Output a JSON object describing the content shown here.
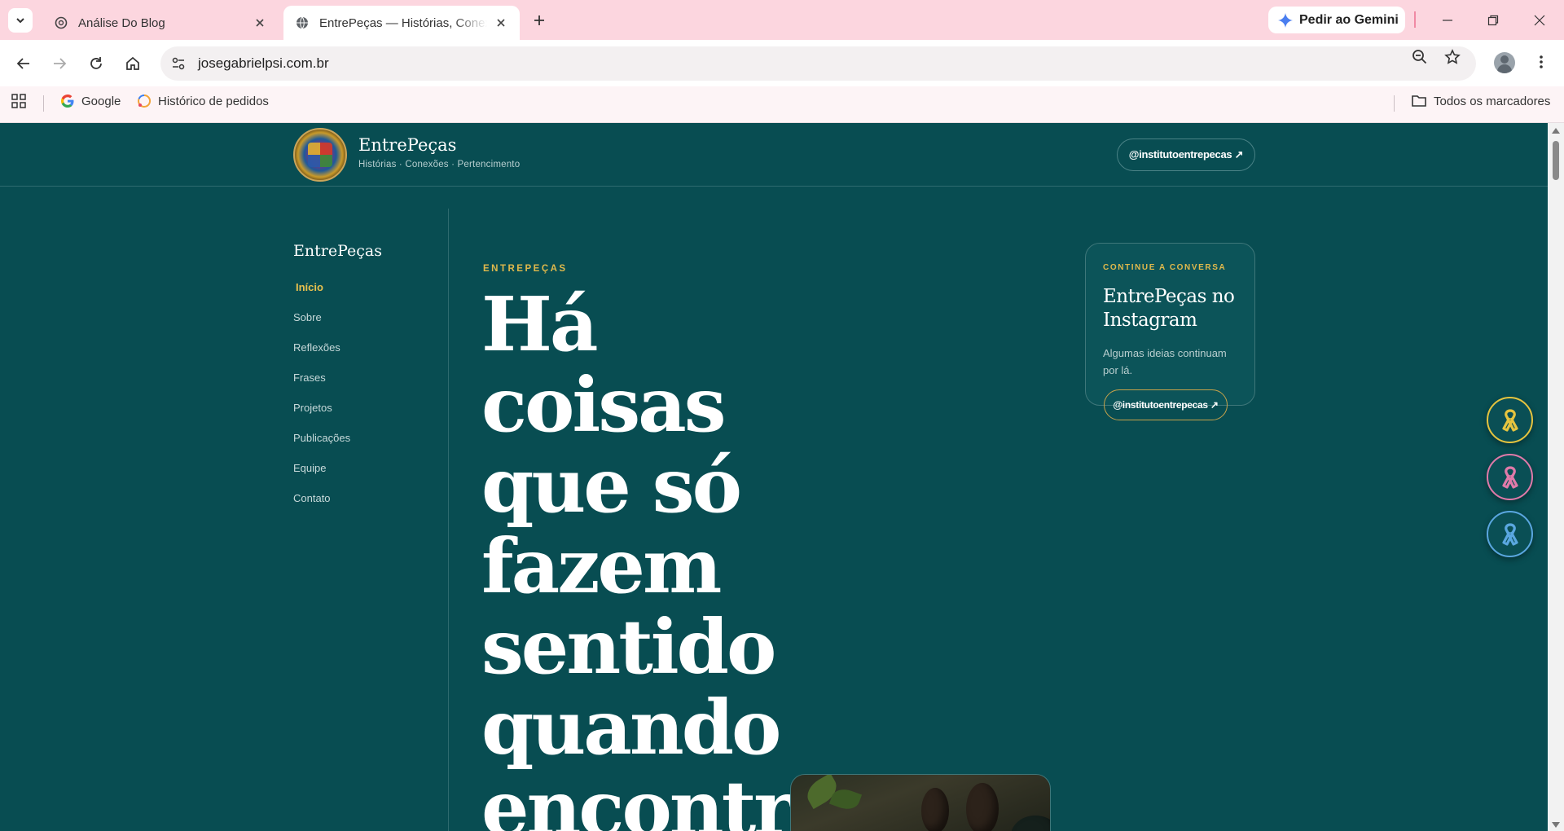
{
  "browser": {
    "tabs": [
      {
        "title": "Análise Do Blog",
        "icon": "openai-icon"
      },
      {
        "title": "EntrePeças — Histórias, Conexões e Pertencimento",
        "icon": "globe-icon"
      }
    ],
    "gemini_label": "Pedir ao Gemini",
    "url": "josegabrielpsi.com.br",
    "bookmarks": [
      {
        "label": "Google"
      },
      {
        "label": "Histórico de pedidos"
      }
    ],
    "all_bookmarks_label": "Todos os marcadores"
  },
  "site": {
    "brand_name": "EntrePeças",
    "brand_tagline": "Histórias · Conexões · Pertencimento",
    "header_instagram": "@institutoentrepecas ↗",
    "sidebar": {
      "title": "EntrePeças",
      "items": [
        {
          "label": "Início",
          "active": true
        },
        {
          "label": "Sobre"
        },
        {
          "label": "Reflexões"
        },
        {
          "label": "Frases"
        },
        {
          "label": "Projetos"
        },
        {
          "label": "Publicações"
        },
        {
          "label": "Equipe"
        },
        {
          "label": "Contato"
        }
      ]
    },
    "hero": {
      "eyebrow": "ENTREPEÇAS",
      "lines": [
        "Há",
        "coisas",
        "que só",
        "fazem",
        "sentido",
        "quando",
        "encontra"
      ]
    },
    "instagram_card": {
      "eyebrow": "CONTINUE A CONVERSA",
      "title": "EntrePeças no Instagram",
      "text": "Algumas ideias continuam por lá.",
      "button": "@institutoentrepecas ↗"
    },
    "ribbons": [
      {
        "color": "#e5c43f",
        "icon": "yellow-ribbon-icon"
      },
      {
        "color": "#e07aa9",
        "icon": "pink-ribbon-icon"
      },
      {
        "color": "#5aa7e0",
        "icon": "blue-ribbon-icon"
      }
    ],
    "colors": {
      "background": "#084d52",
      "accent": "#e0b94c",
      "tabbar": "#fcd6df"
    }
  }
}
